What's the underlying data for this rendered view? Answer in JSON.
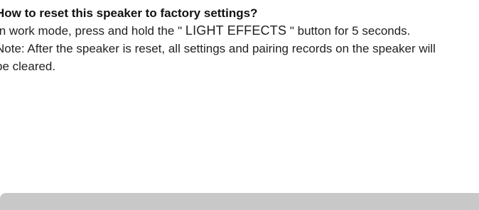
{
  "faq": {
    "question": "How to reset this speaker to factory settings?",
    "answer": {
      "prefix": "In work mode, press and hold the \" ",
      "button_name": "LIGHT EFFECTS",
      "suffix": " \" button for 5 seconds."
    },
    "note_line1": "Note: After the speaker is reset, all settings and pairing records on the speaker will",
    "note_line2": "be cleared."
  },
  "colors": {
    "text": "#222222",
    "heading": "#111111",
    "bottom_bar": "#c8c8c8",
    "background": "#ffffff"
  }
}
